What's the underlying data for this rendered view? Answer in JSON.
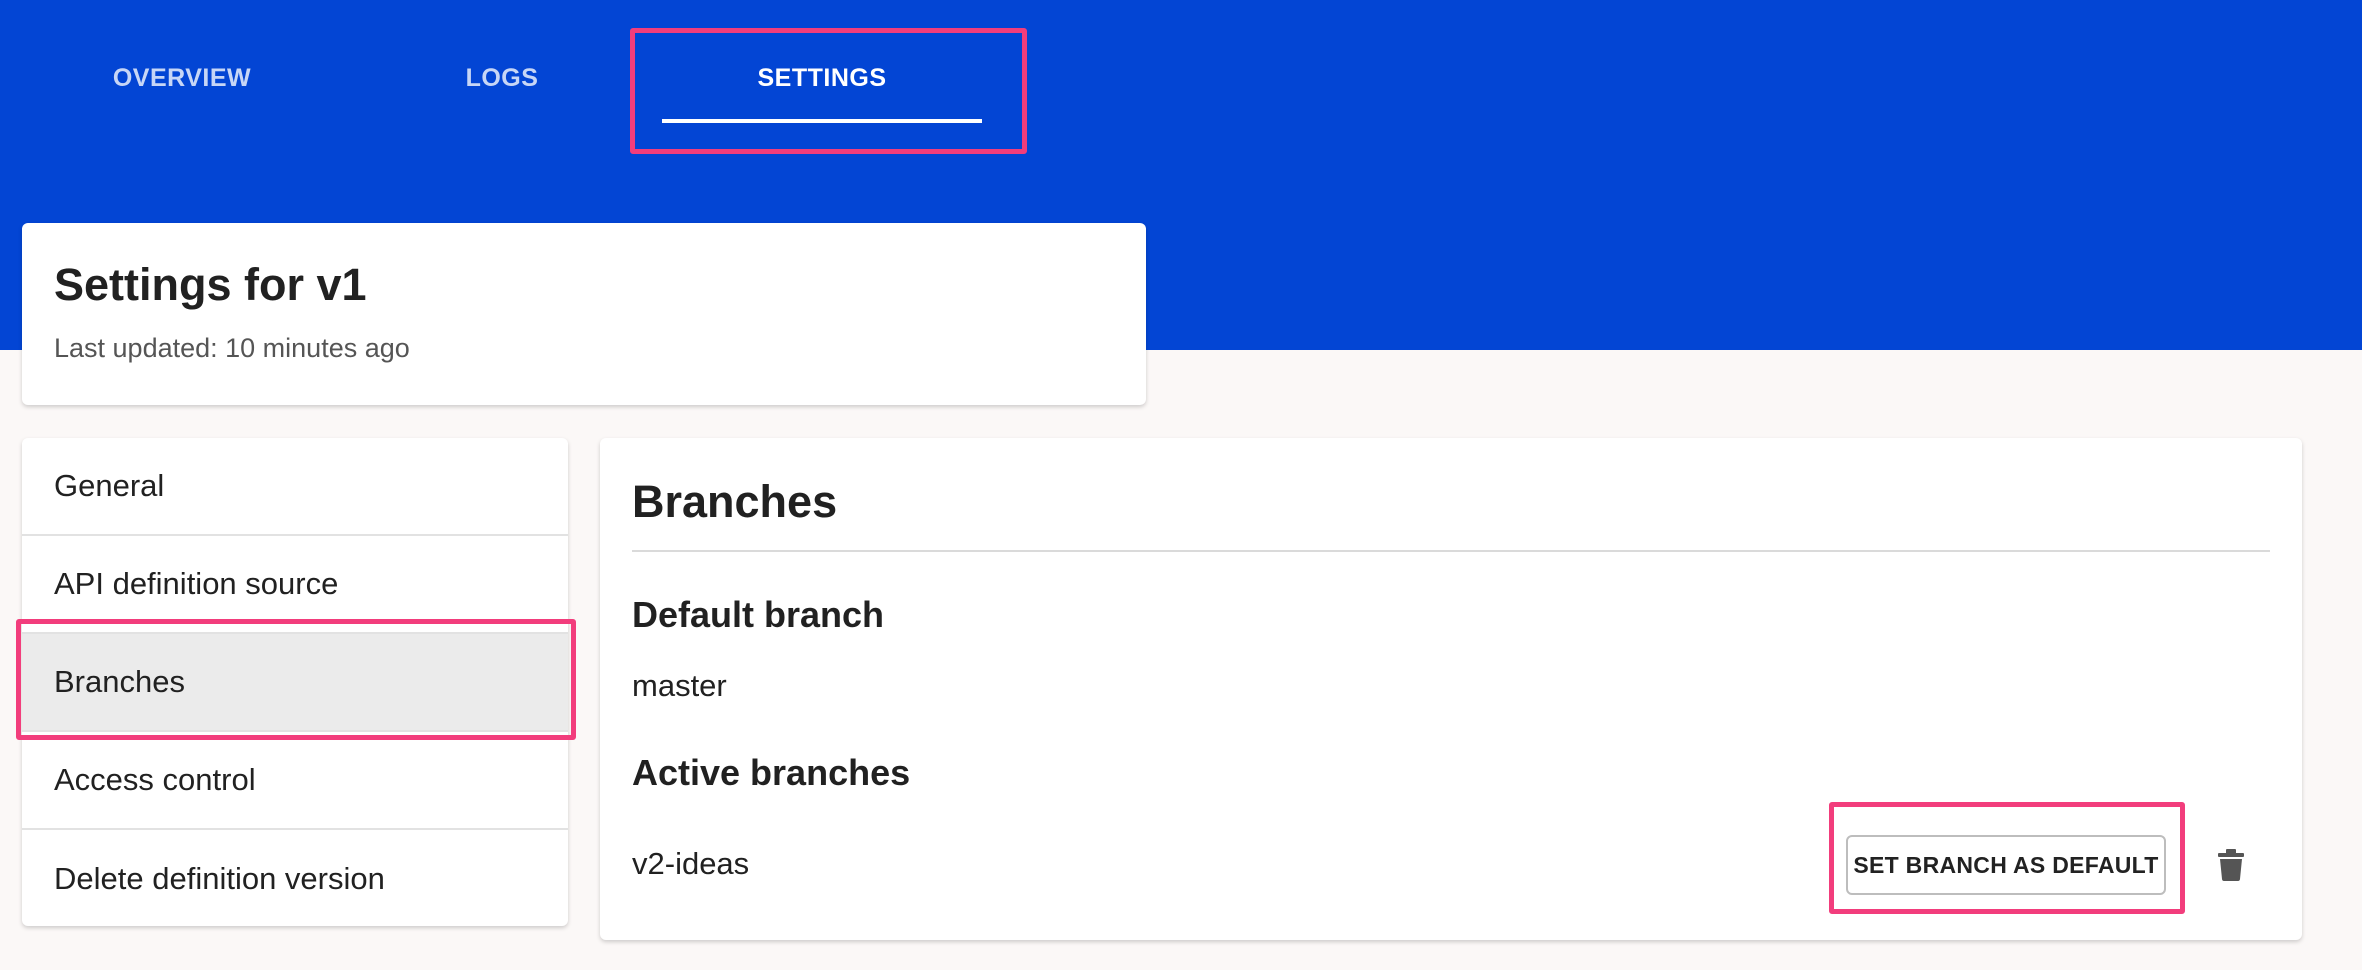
{
  "tabs": [
    {
      "label": "OVERVIEW"
    },
    {
      "label": "LOGS"
    },
    {
      "label": "SETTINGS",
      "active": true
    }
  ],
  "title_card": {
    "title": "Settings for v1",
    "subtitle": "Last updated: 10 minutes ago"
  },
  "sidebar": {
    "items": [
      {
        "label": "General"
      },
      {
        "label": "API definition source"
      },
      {
        "label": "Branches",
        "active": true
      },
      {
        "label": "Access control"
      },
      {
        "label": "Delete definition version"
      }
    ]
  },
  "panel": {
    "title": "Branches",
    "default_heading": "Default branch",
    "default_branch": "master",
    "active_heading": "Active branches",
    "active_branches": [
      {
        "name": "v2-ideas",
        "set_default_label": "SET BRANCH AS DEFAULT",
        "delete_icon": "trash-icon"
      }
    ]
  },
  "colors": {
    "header_blue": "#0345d4",
    "highlight": "#f23d7c",
    "active_row": "#ebebeb"
  }
}
